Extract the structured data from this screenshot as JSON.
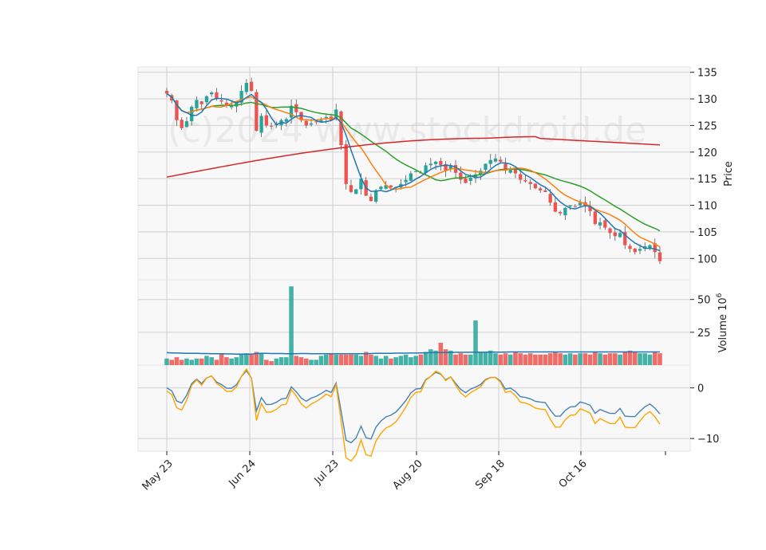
{
  "chart_data": {
    "type": "candlestick",
    "watermark": "(c)2024 www.stockdroid.de",
    "x_tick_labels": [
      "May 23",
      "Jun 24",
      "Jul 23",
      "Aug 20",
      "Sep 18",
      "Oct 16"
    ],
    "panels": {
      "price": {
        "ylabel": "Price",
        "ylim": [
          96,
          136
        ],
        "yticks": [
          100,
          105,
          110,
          115,
          120,
          125,
          130,
          135
        ],
        "ma_colors": {
          "ma1": "#1f77b4",
          "ma2": "#ff7f0e",
          "ma3": "#2ca02c",
          "ma4": "#d62728"
        },
        "up_color": "#26a69a",
        "down_color": "#ef5350"
      },
      "volume": {
        "ylabel": "Volume",
        "ylabel_exponent": "6",
        "ylim": [
          0,
          65
        ],
        "yticks": [
          25,
          50
        ],
        "up_color": "#26a69a",
        "down_color": "#ef5350",
        "avg_color": "#1f77b4"
      },
      "oscillator": {
        "ylim": [
          -12.5,
          4.5
        ],
        "yticks": [
          -10,
          0
        ],
        "colors": {
          "line1": "#4682b4",
          "line2": "#ffa500"
        }
      }
    },
    "closes": [
      131,
      129.7,
      126,
      124.5,
      125.8,
      128.5,
      129.8,
      129,
      130.5,
      131.2,
      130,
      129.5,
      128.7,
      128.7,
      129.5,
      131.5,
      133,
      131.5,
      124,
      126.8,
      125,
      124.8,
      125.2,
      126,
      126.2,
      128.7,
      127.5,
      126,
      125,
      125.4,
      125.6,
      126,
      126.6,
      126,
      128,
      121.3,
      114,
      112.5,
      113,
      115,
      111.8,
      110.8,
      112.8,
      113.5,
      113.8,
      113.4,
      113.4,
      114,
      114.8,
      116,
      116.4,
      116,
      117.5,
      117.8,
      118.2,
      117.6,
      116.5,
      117.4,
      116.1,
      114.8,
      114.2,
      115.2,
      115.8,
      116.5,
      117.8,
      118.5,
      118.8,
      118.2,
      116.5,
      116.8,
      116,
      114.8,
      114.5,
      114,
      113.2,
      112.8,
      112.5,
      110.5,
      108.8,
      108.5,
      109.5,
      110,
      109.8,
      110.5,
      109.8,
      108.9,
      106.5,
      106.8,
      105.8,
      104.8,
      104.2,
      104.8,
      102.5,
      101.8,
      101.2,
      101.8,
      102.3,
      102.5,
      101.2,
      99.5
    ],
    "volumes": [
      5,
      4,
      6,
      4,
      5,
      4,
      5,
      5,
      7,
      6,
      4,
      9,
      6,
      5,
      6,
      8,
      9,
      8,
      10,
      9,
      4,
      3,
      5,
      6,
      6,
      6,
      7,
      6,
      5,
      4,
      4,
      7,
      8,
      9,
      8,
      8,
      8,
      8,
      8,
      7,
      10,
      8,
      7,
      5,
      7,
      5,
      6,
      7,
      8,
      6,
      7,
      8,
      10,
      12,
      11,
      17,
      12,
      11,
      8,
      9,
      8,
      8,
      12,
      10,
      10,
      11,
      9,
      8,
      9,
      8,
      10,
      9,
      8,
      9,
      8,
      8,
      8,
      9,
      10,
      9,
      8,
      9,
      8,
      9,
      9,
      8,
      10,
      9,
      8,
      9,
      9,
      8,
      10,
      11,
      10,
      9,
      9,
      8,
      10,
      9
    ],
    "volume_spikes": {
      "25": 60,
      "62": 34
    },
    "volume_avg": [
      9.5,
      9.3,
      9.2,
      9.1,
      9.0,
      9.0,
      8.9,
      8.8,
      8.8,
      8.7,
      8.6,
      8.6,
      8.5,
      8.5,
      8.4,
      8.4,
      8.3,
      8.3,
      8.8,
      9.0,
      8.9,
      8.8,
      8.8,
      8.8,
      8.7,
      8.7,
      8.7,
      8.8,
      8.8,
      8.7,
      8.7,
      8.6,
      8.6,
      8.6,
      8.6,
      8.6,
      8.6,
      8.6,
      8.6,
      8.6,
      8.7,
      8.8,
      8.9,
      9.0,
      9.0,
      9.0,
      9.1,
      9.1,
      9.1,
      9.2,
      9.2,
      9.3,
      9.4,
      9.5,
      9.5,
      9.6,
      9.6,
      9.6,
      9.7,
      9.7,
      9.7,
      9.8,
      9.8,
      9.8,
      9.8,
      9.9,
      9.9,
      9.9,
      9.9,
      10,
      10,
      10,
      10,
      10,
      10,
      10,
      10,
      10,
      10,
      10,
      10,
      10,
      10,
      10,
      10,
      10,
      10,
      10,
      10,
      10,
      10,
      10,
      10,
      10,
      10,
      10,
      10,
      10,
      10,
      10
    ]
  }
}
